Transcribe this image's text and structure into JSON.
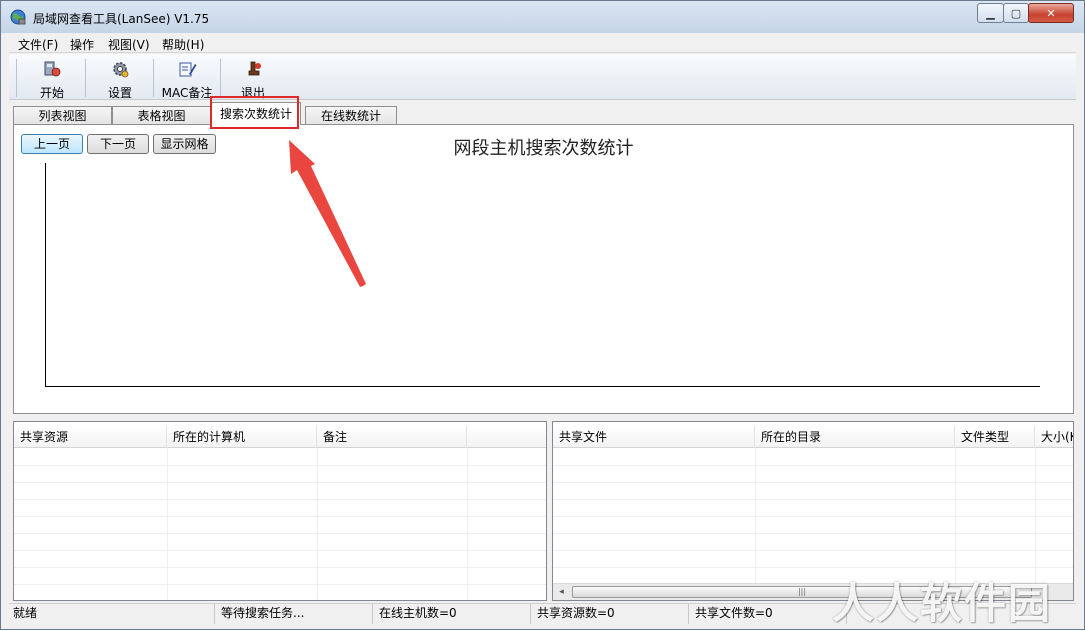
{
  "window": {
    "title": "局域网查看工具(LanSee) V1.75",
    "icon": "globe-app-icon"
  },
  "menu": [
    {
      "label": "文件(F)"
    },
    {
      "label": "操作"
    },
    {
      "label": "视图(V)"
    },
    {
      "label": "帮助(H)"
    }
  ],
  "toolbar": {
    "start": {
      "label": "开始",
      "icon": "start-icon"
    },
    "settings": {
      "label": "设置",
      "icon": "gear-icon"
    },
    "mac_note": {
      "label": "MAC备注",
      "icon": "note-edit-icon"
    },
    "exit": {
      "label": "退出",
      "icon": "exit-icon"
    }
  },
  "tabs": [
    {
      "label": "列表视图"
    },
    {
      "label": "表格视图"
    },
    {
      "label": "搜索次数统计",
      "active": true
    },
    {
      "label": "在线数统计"
    }
  ],
  "chart_panel": {
    "prev_button": "上一页",
    "next_button": "下一页",
    "grid_button": "显示网格",
    "title": "网段主机搜索次数统计"
  },
  "shares_list": {
    "columns": [
      "共享资源",
      "所在的计算机",
      "备注",
      ""
    ]
  },
  "files_list": {
    "columns": [
      "共享文件",
      "所在的目录",
      "文件类型",
      "大小(K"
    ],
    "scroll_left": "◂",
    "scroll_grip": "|||"
  },
  "status": {
    "state": "就绪",
    "task": "等待搜索任务...",
    "online_hosts": "在线主机数=0",
    "shared_resources": "共享资源数=0",
    "shared_files": "共享文件数=0"
  },
  "watermark": "人人软件园",
  "colors": {
    "highlight": "#e02a2a",
    "arrow": "#e8463f",
    "active_button": "#bee6fd"
  }
}
